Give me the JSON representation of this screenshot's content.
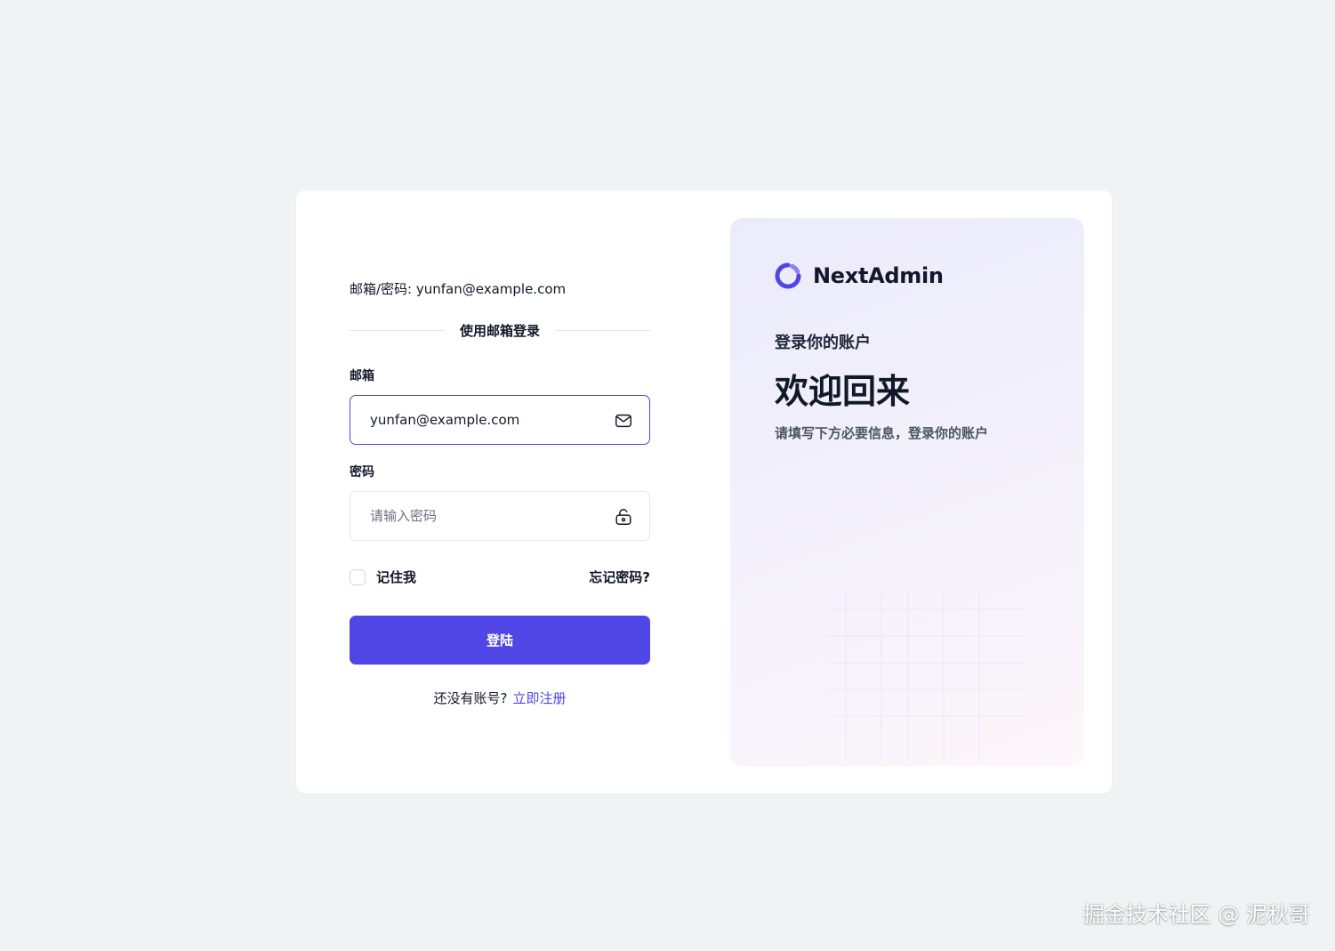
{
  "colors": {
    "accent": "#4f46e5",
    "page_background": "#f1f2f4",
    "card_background": "#ffffff"
  },
  "login_form": {
    "hint": "邮箱/密码: yunfan@example.com",
    "divider_text": "使用邮箱登录",
    "email": {
      "label": "邮箱",
      "value": "yunfan@example.com",
      "icon": "mail-icon"
    },
    "password": {
      "label": "密码",
      "placeholder": "请输入密码",
      "icon": "unlock-icon"
    },
    "remember_label": "记住我",
    "remember_checked": false,
    "forgot_label": "忘记密码?",
    "submit_label": "登陆",
    "signup_prompt": "还没有账号?",
    "signup_link": "立即注册"
  },
  "brand_panel": {
    "logo_text": "NextAdmin",
    "logo_icon": "logo-ring-icon",
    "subtitle": "登录你的账户",
    "title": "欢迎回来",
    "description": "请填写下方必要信息，登录你的账户"
  },
  "watermark": "掘金技术社区 @ 泥秋哥"
}
